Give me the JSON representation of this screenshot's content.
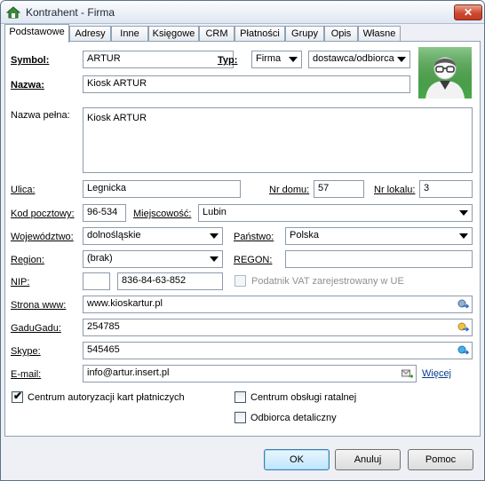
{
  "window": {
    "title": "Kontrahent - Firma",
    "close_label": "✕"
  },
  "tabs": [
    "Podstawowe",
    "Adresy",
    "Inne",
    "Księgowe",
    "CRM",
    "Płatności",
    "Grupy",
    "Opis",
    "Własne"
  ],
  "form": {
    "symbol_label": "Symbol:",
    "symbol_value": "ARTUR",
    "typ_label": "Typ:",
    "typ_value": "Firma",
    "typ2_value": "dostawca/odbiorca",
    "nazwa_label": "Nazwa:",
    "nazwa_value": "Kiosk ARTUR",
    "pelna_label": "Nazwa pełna:",
    "pelna_value": "Kiosk ARTUR",
    "ulica_label": "Ulica:",
    "ulica_value": "Legnicka",
    "nrdomu_label": "Nr domu:",
    "nrdomu_value": "57",
    "nrlokalu_label": "Nr lokalu:",
    "nrlokalu_value": "3",
    "kod_label": "Kod pocztowy:",
    "kod_value": "96-534",
    "miejsc_label": "Miejscowość:",
    "miejsc_value": "Lubin",
    "woj_label": "Województwo:",
    "woj_value": "dolnośląskie",
    "panstwo_label": "Państwo:",
    "panstwo_value": "Polska",
    "region_label": "Region:",
    "region_value": "(brak)",
    "regon_label": "REGON:",
    "regon_value": "",
    "nip_label": "NIP:",
    "nip_prefix": "",
    "nip_value": "836-84-63-852",
    "vat_label": "Podatnik VAT zarejestrowany w UE",
    "www_label": "Strona www:",
    "www_value": "www.kioskartur.pl",
    "gg_label": "GaduGadu:",
    "gg_value": "254785",
    "skype_label": "Skype:",
    "skype_value": "545465",
    "email_label": "E-mail:",
    "email_value": "info@artur.insert.pl",
    "more_link": "Więcej",
    "cb_centrum_label": "Centrum autoryzacji kart płatniczych",
    "cb_centrum_checked": true,
    "cb_ratalnej_label": "Centrum obsługi ratalnej",
    "cb_ratalnej_checked": false,
    "cb_detal_label": "Odbiorca detaliczny",
    "cb_detal_checked": false
  },
  "buttons": {
    "ok": "OK",
    "cancel": "Anuluj",
    "help": "Pomoc"
  },
  "colors": {
    "accent": "#3c7fb1",
    "avatar_bg": "#4aa84a"
  }
}
